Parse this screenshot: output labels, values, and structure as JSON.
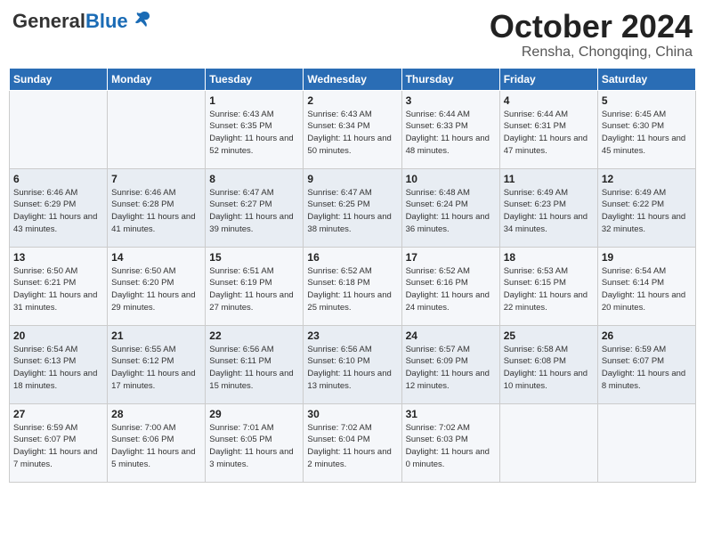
{
  "header": {
    "logo_general": "General",
    "logo_blue": "Blue",
    "month": "October 2024",
    "location": "Rensha, Chongqing, China"
  },
  "weekdays": [
    "Sunday",
    "Monday",
    "Tuesday",
    "Wednesday",
    "Thursday",
    "Friday",
    "Saturday"
  ],
  "weeks": [
    [
      {
        "day": "",
        "detail": ""
      },
      {
        "day": "",
        "detail": ""
      },
      {
        "day": "1",
        "detail": "Sunrise: 6:43 AM\nSunset: 6:35 PM\nDaylight: 11 hours\nand 52 minutes."
      },
      {
        "day": "2",
        "detail": "Sunrise: 6:43 AM\nSunset: 6:34 PM\nDaylight: 11 hours\nand 50 minutes."
      },
      {
        "day": "3",
        "detail": "Sunrise: 6:44 AM\nSunset: 6:33 PM\nDaylight: 11 hours\nand 48 minutes."
      },
      {
        "day": "4",
        "detail": "Sunrise: 6:44 AM\nSunset: 6:31 PM\nDaylight: 11 hours\nand 47 minutes."
      },
      {
        "day": "5",
        "detail": "Sunrise: 6:45 AM\nSunset: 6:30 PM\nDaylight: 11 hours\nand 45 minutes."
      }
    ],
    [
      {
        "day": "6",
        "detail": "Sunrise: 6:46 AM\nSunset: 6:29 PM\nDaylight: 11 hours\nand 43 minutes."
      },
      {
        "day": "7",
        "detail": "Sunrise: 6:46 AM\nSunset: 6:28 PM\nDaylight: 11 hours\nand 41 minutes."
      },
      {
        "day": "8",
        "detail": "Sunrise: 6:47 AM\nSunset: 6:27 PM\nDaylight: 11 hours\nand 39 minutes."
      },
      {
        "day": "9",
        "detail": "Sunrise: 6:47 AM\nSunset: 6:25 PM\nDaylight: 11 hours\nand 38 minutes."
      },
      {
        "day": "10",
        "detail": "Sunrise: 6:48 AM\nSunset: 6:24 PM\nDaylight: 11 hours\nand 36 minutes."
      },
      {
        "day": "11",
        "detail": "Sunrise: 6:49 AM\nSunset: 6:23 PM\nDaylight: 11 hours\nand 34 minutes."
      },
      {
        "day": "12",
        "detail": "Sunrise: 6:49 AM\nSunset: 6:22 PM\nDaylight: 11 hours\nand 32 minutes."
      }
    ],
    [
      {
        "day": "13",
        "detail": "Sunrise: 6:50 AM\nSunset: 6:21 PM\nDaylight: 11 hours\nand 31 minutes."
      },
      {
        "day": "14",
        "detail": "Sunrise: 6:50 AM\nSunset: 6:20 PM\nDaylight: 11 hours\nand 29 minutes."
      },
      {
        "day": "15",
        "detail": "Sunrise: 6:51 AM\nSunset: 6:19 PM\nDaylight: 11 hours\nand 27 minutes."
      },
      {
        "day": "16",
        "detail": "Sunrise: 6:52 AM\nSunset: 6:18 PM\nDaylight: 11 hours\nand 25 minutes."
      },
      {
        "day": "17",
        "detail": "Sunrise: 6:52 AM\nSunset: 6:16 PM\nDaylight: 11 hours\nand 24 minutes."
      },
      {
        "day": "18",
        "detail": "Sunrise: 6:53 AM\nSunset: 6:15 PM\nDaylight: 11 hours\nand 22 minutes."
      },
      {
        "day": "19",
        "detail": "Sunrise: 6:54 AM\nSunset: 6:14 PM\nDaylight: 11 hours\nand 20 minutes."
      }
    ],
    [
      {
        "day": "20",
        "detail": "Sunrise: 6:54 AM\nSunset: 6:13 PM\nDaylight: 11 hours\nand 18 minutes."
      },
      {
        "day": "21",
        "detail": "Sunrise: 6:55 AM\nSunset: 6:12 PM\nDaylight: 11 hours\nand 17 minutes."
      },
      {
        "day": "22",
        "detail": "Sunrise: 6:56 AM\nSunset: 6:11 PM\nDaylight: 11 hours\nand 15 minutes."
      },
      {
        "day": "23",
        "detail": "Sunrise: 6:56 AM\nSunset: 6:10 PM\nDaylight: 11 hours\nand 13 minutes."
      },
      {
        "day": "24",
        "detail": "Sunrise: 6:57 AM\nSunset: 6:09 PM\nDaylight: 11 hours\nand 12 minutes."
      },
      {
        "day": "25",
        "detail": "Sunrise: 6:58 AM\nSunset: 6:08 PM\nDaylight: 11 hours\nand 10 minutes."
      },
      {
        "day": "26",
        "detail": "Sunrise: 6:59 AM\nSunset: 6:07 PM\nDaylight: 11 hours\nand 8 minutes."
      }
    ],
    [
      {
        "day": "27",
        "detail": "Sunrise: 6:59 AM\nSunset: 6:07 PM\nDaylight: 11 hours\nand 7 minutes."
      },
      {
        "day": "28",
        "detail": "Sunrise: 7:00 AM\nSunset: 6:06 PM\nDaylight: 11 hours\nand 5 minutes."
      },
      {
        "day": "29",
        "detail": "Sunrise: 7:01 AM\nSunset: 6:05 PM\nDaylight: 11 hours\nand 3 minutes."
      },
      {
        "day": "30",
        "detail": "Sunrise: 7:02 AM\nSunset: 6:04 PM\nDaylight: 11 hours\nand 2 minutes."
      },
      {
        "day": "31",
        "detail": "Sunrise: 7:02 AM\nSunset: 6:03 PM\nDaylight: 11 hours\nand 0 minutes."
      },
      {
        "day": "",
        "detail": ""
      },
      {
        "day": "",
        "detail": ""
      }
    ]
  ]
}
